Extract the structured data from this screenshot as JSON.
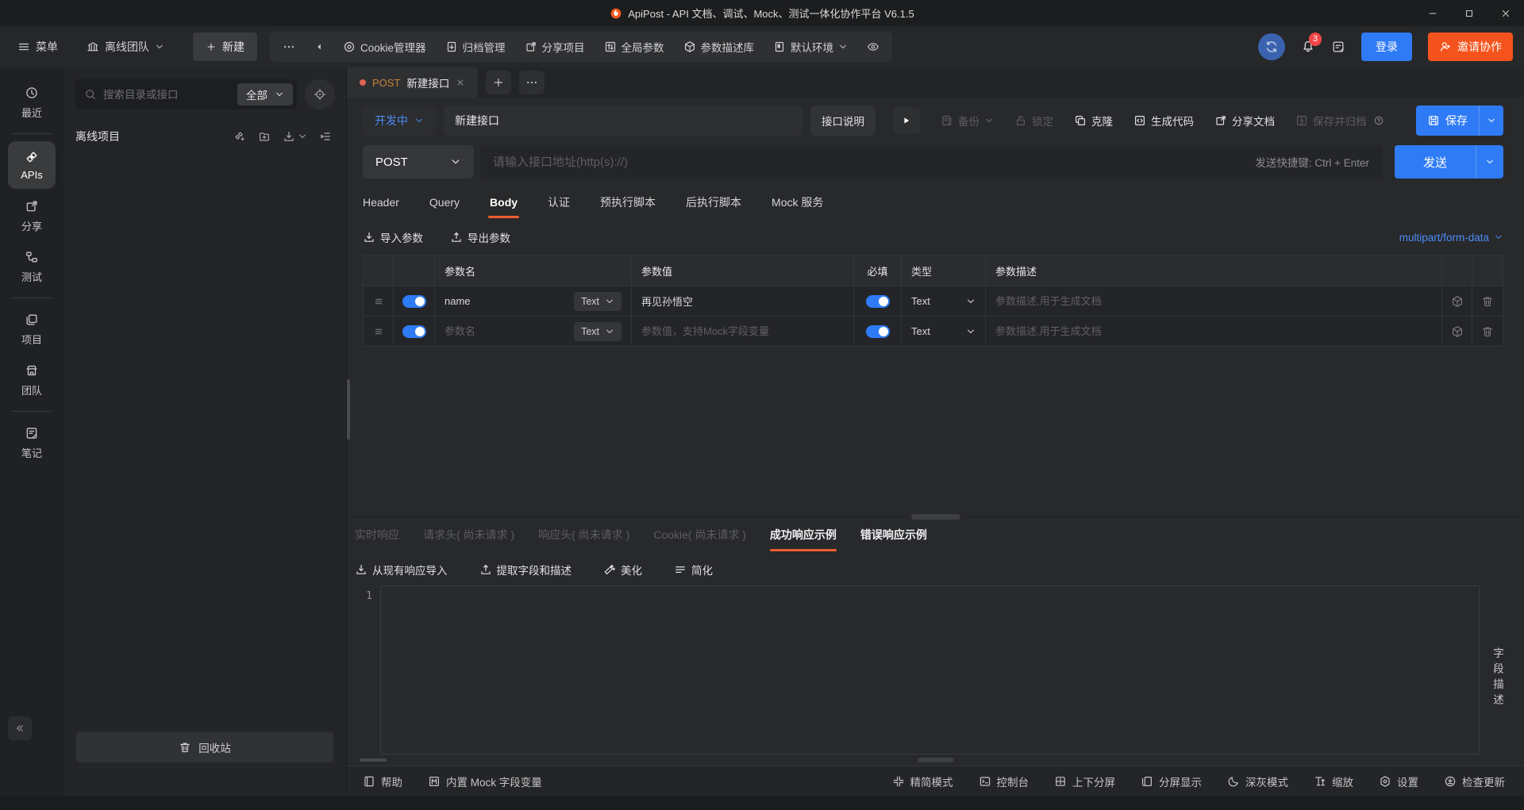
{
  "window": {
    "title": "ApiPost - API 文档、调试、Mock、测试一体化协作平台 V6.1.5"
  },
  "topbar": {
    "menu_label": "菜单",
    "team_label": "离线团队",
    "new_label": "新建",
    "nav_items": [
      {
        "label": "Cookie管理器"
      },
      {
        "label": "归档管理"
      },
      {
        "label": "分享项目"
      },
      {
        "label": "全局参数"
      },
      {
        "label": "参数描述库"
      },
      {
        "label": "默认环境"
      }
    ],
    "notification_count": "3",
    "login_label": "登录",
    "invite_label": "邀请协作"
  },
  "sidebar": {
    "items": [
      {
        "label": "最近"
      },
      {
        "label": "APIs"
      },
      {
        "label": "分享"
      },
      {
        "label": "测试"
      },
      {
        "label": "项目"
      },
      {
        "label": "团队"
      },
      {
        "label": "笔记"
      }
    ],
    "active": "APIs"
  },
  "explorer": {
    "search_placeholder": "搜索目录或接口",
    "filter_label": "全部",
    "project_label": "离线项目",
    "recycle_label": "回收站"
  },
  "doc_tab": {
    "method": "POST",
    "title": "新建接口"
  },
  "doc_bar": {
    "status_label": "开发中",
    "name_value": "新建接口",
    "desc_label": "接口说明",
    "backup_label": "备份",
    "lock_label": "锁定",
    "clone_label": "克隆",
    "gencode_label": "生成代码",
    "sharedoc_label": "分享文档",
    "archive_label": "保存并归档",
    "save_label": "保存"
  },
  "request_bar": {
    "method": "POST",
    "url_placeholder": "请输入接口地址(http(s)://)",
    "shortcut_hint": "发送快捷键: Ctrl + Enter",
    "send_label": "发送"
  },
  "request_tabs": {
    "items": [
      {
        "label": "Header"
      },
      {
        "label": "Query"
      },
      {
        "label": "Body"
      },
      {
        "label": "认证"
      },
      {
        "label": "预执行脚本"
      },
      {
        "label": "后执行脚本"
      },
      {
        "label": "Mock 服务"
      }
    ],
    "active": "Body"
  },
  "body_toolbar": {
    "import_label": "导入参数",
    "export_label": "导出参数",
    "content_type": "multipart/form-data"
  },
  "param_table": {
    "headers": {
      "name": "参数名",
      "value": "参数值",
      "required": "必填",
      "type": "类型",
      "description": "参数描述"
    },
    "rows": [
      {
        "enabled": true,
        "name": "name",
        "name_type": "Text",
        "value": "再见孙悟空",
        "required": true,
        "type": "Text",
        "desc_placeholder": "参数描述,用于生成文档"
      },
      {
        "enabled": true,
        "name_placeholder": "参数名",
        "name_type": "Text",
        "value_placeholder": "参数值，支持Mock字段变量",
        "required": true,
        "type": "Text",
        "desc_placeholder": "参数描述,用于生成文档"
      }
    ]
  },
  "response_tabs": {
    "items": [
      {
        "label": "实时响应",
        "disabled": true
      },
      {
        "label": "请求头( 尚未请求 )",
        "disabled": true
      },
      {
        "label": "响应头( 尚未请求 )",
        "disabled": true
      },
      {
        "label": "Cookie( 尚未请求 )",
        "disabled": true
      },
      {
        "label": "成功响应示例",
        "disabled": false
      },
      {
        "label": "错误响应示例",
        "disabled": false
      }
    ],
    "active": "成功响应示例"
  },
  "response_toolbar": {
    "import_label": "从现有响应导入",
    "extract_label": "提取字段和描述",
    "beautify_label": "美化",
    "simplify_label": "简化"
  },
  "editor": {
    "line_number": "1",
    "content": ""
  },
  "field_desc_panel": {
    "label": "字段描述"
  },
  "status_bar": {
    "left_items": [
      {
        "label": "帮助"
      },
      {
        "label": "内置 Mock 字段变量"
      }
    ],
    "right_items": [
      {
        "label": "精简模式"
      },
      {
        "label": "控制台"
      },
      {
        "label": "上下分屏"
      },
      {
        "label": "分屏显示"
      },
      {
        "label": "深灰模式"
      },
      {
        "label": "缩放"
      },
      {
        "label": "设置"
      },
      {
        "label": "检查更新"
      }
    ]
  },
  "colors": {
    "accent_blue": "#2f7bf5",
    "accent_orange": "#f5531d",
    "method_orange": "#c9843e",
    "tab_dot_red": "#e26352",
    "active_underline": "#f05e2e",
    "toggle_on": "#2f7bf5",
    "notification_red": "#f24545"
  },
  "icons": {
    "apipost-logo": "orange flame circle",
    "search": "magnifier",
    "bell": "notifications",
    "sync": "circular arrows",
    "eye": "environment preview",
    "cube": "parameter library",
    "trash": "delete",
    "drag-handle": "three lines",
    "moon": "dark mode",
    "gear-hex": "settings"
  }
}
